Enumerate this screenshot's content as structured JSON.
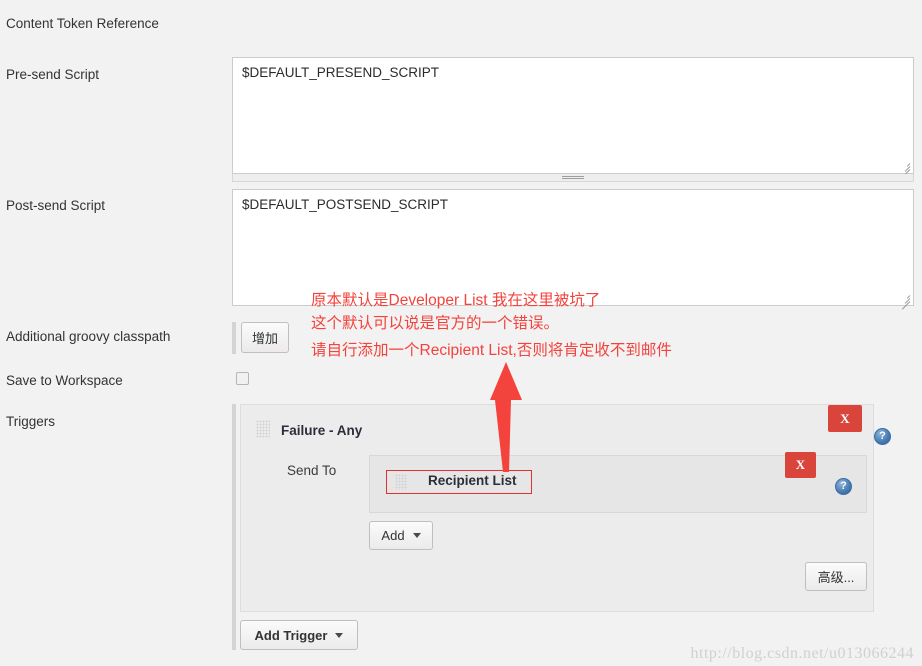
{
  "header": {
    "content_token_reference": "Content Token Reference"
  },
  "fields": {
    "presend": {
      "label": "Pre-send Script",
      "value": "$DEFAULT_PRESEND_SCRIPT"
    },
    "postsend": {
      "label": "Post-send Script",
      "value": "$DEFAULT_POSTSEND_SCRIPT"
    },
    "classpath": {
      "label": "Additional groovy classpath",
      "add_button": "增加"
    },
    "save_workspace": {
      "label": "Save to Workspace",
      "checked": false
    },
    "triggers": {
      "label": "Triggers"
    }
  },
  "trigger": {
    "title": "Failure - Any",
    "send_to_label": "Send To",
    "recipient_chip": "Recipient List",
    "add_button": "Add",
    "advanced_button": "高级...",
    "add_trigger_button": "Add Trigger",
    "close_label": "X",
    "help_label": "?"
  },
  "annotation": {
    "line1": "原本默认是Developer List 我在这里被坑了",
    "line2": "这个默认可以说是官方的一个错误。",
    "line3": "请自行添加一个Recipient List,否则将肯定收不到邮件",
    "color": "#f4423c"
  },
  "watermark": {
    "text": "http://blog.csdn.net/u013066244"
  },
  "colors": {
    "page_background": "#f2f2f2",
    "close_button": "#d9453b",
    "help_icon": "#4a7fb5",
    "panel": "#ececec",
    "highlight_border": "#e03030"
  }
}
